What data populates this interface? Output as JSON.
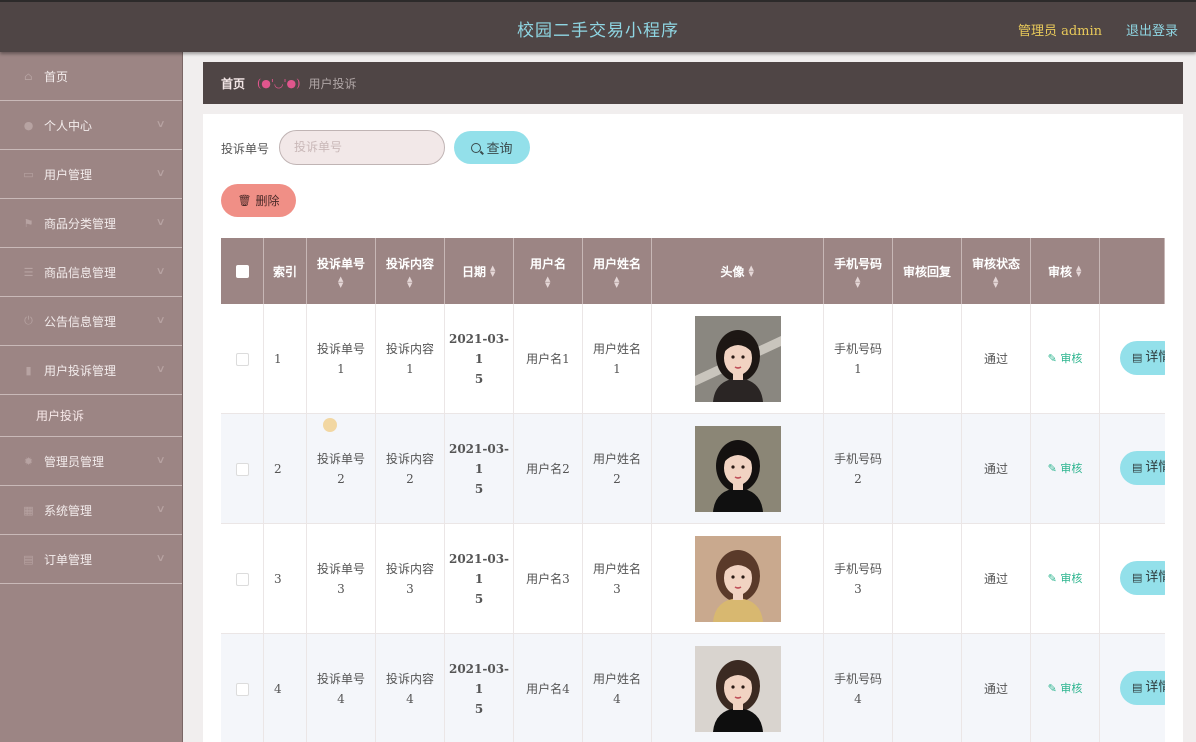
{
  "header": {
    "title": "校园二手交易小程序",
    "admin_label": "管理员 admin",
    "logout_label": "退出登录"
  },
  "sidebar": {
    "items": [
      {
        "label": "首页",
        "icon": "home-icon",
        "glyph": "⌂",
        "expandable": false
      },
      {
        "label": "个人中心",
        "icon": "user-icon",
        "glyph": "●",
        "expandable": true
      },
      {
        "label": "用户管理",
        "icon": "id-card-icon",
        "glyph": "▭",
        "expandable": true
      },
      {
        "label": "商品分类管理",
        "icon": "flag-icon",
        "glyph": "⚑",
        "expandable": true
      },
      {
        "label": "商品信息管理",
        "icon": "list-icon",
        "glyph": "☰",
        "expandable": true
      },
      {
        "label": "公告信息管理",
        "icon": "power-icon",
        "glyph": "⏻",
        "expandable": true
      },
      {
        "label": "用户投诉管理",
        "icon": "bar-chart-icon",
        "glyph": "▮",
        "expandable": true
      },
      {
        "label": "管理员管理",
        "icon": "gear-icon",
        "glyph": "✹",
        "expandable": true
      },
      {
        "label": "系统管理",
        "icon": "grid-icon",
        "glyph": "▦",
        "expandable": true
      },
      {
        "label": "订单管理",
        "icon": "document-icon",
        "glyph": "▤",
        "expandable": true
      }
    ],
    "sub_item": "用户投诉"
  },
  "breadcrumb": {
    "home": "首页",
    "separator": "(●'◡'●)",
    "current": "用户投诉"
  },
  "search": {
    "label": "投诉单号",
    "placeholder": "投诉单号",
    "button": "查询"
  },
  "actions": {
    "delete": "删除"
  },
  "table": {
    "headers": [
      "索引",
      "投诉单号",
      "投诉内容",
      "日期",
      "用户名",
      "用户姓名",
      "头像",
      "手机号码",
      "审核回复",
      "审核状态",
      "审核"
    ],
    "rows": [
      {
        "index": "1",
        "complaint_no": "投诉单号1",
        "content": "投诉内容1",
        "date": "2021-03-15",
        "username": "用户名1",
        "name": "用户姓名1",
        "phone": "手机号码1",
        "reply": "",
        "status": "通过",
        "audit": "审核",
        "detail": "详情"
      },
      {
        "index": "2",
        "complaint_no": "投诉单号2",
        "content": "投诉内容2",
        "date": "2021-03-15",
        "username": "用户名2",
        "name": "用户姓名2",
        "phone": "手机号码2",
        "reply": "",
        "status": "通过",
        "audit": "审核",
        "detail": "详情"
      },
      {
        "index": "3",
        "complaint_no": "投诉单号3",
        "content": "投诉内容3",
        "date": "2021-03-15",
        "username": "用户名3",
        "name": "用户姓名3",
        "phone": "手机号码3",
        "reply": "",
        "status": "通过",
        "audit": "审核",
        "detail": "详情"
      },
      {
        "index": "4",
        "complaint_no": "投诉单号4",
        "content": "投诉内容4",
        "date": "2021-03-15",
        "username": "用户名4",
        "name": "用户姓名4",
        "phone": "手机号码4",
        "reply": "",
        "status": "通过",
        "audit": "审核",
        "detail": "详情"
      }
    ]
  },
  "colors": {
    "header_bg": "#4f4545",
    "sidebar_bg": "#9c8584",
    "accent_cyan": "#93e0ea",
    "danger": "#f08f86",
    "link_green": "#2bb48e"
  }
}
